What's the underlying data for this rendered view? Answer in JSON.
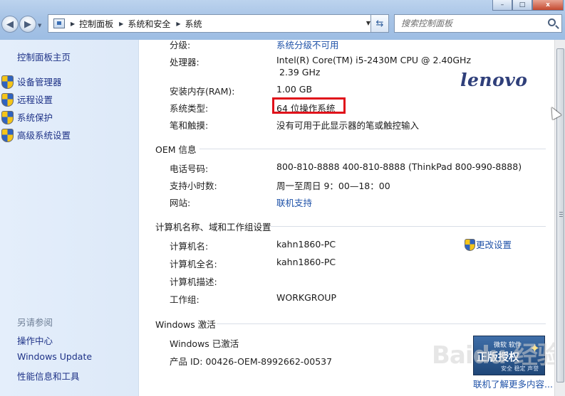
{
  "titlebar": {
    "back_icon": "back-arrow-icon",
    "forward_icon": "forward-arrow-icon",
    "breadcrumbs": [
      "控制面板",
      "系统和安全",
      "系统"
    ],
    "search_placeholder": "搜索控制面板",
    "window_buttons": {
      "minimize": "–",
      "maximize": "□",
      "close": "x"
    }
  },
  "sidebar": {
    "home_link": "控制面板主页",
    "items": [
      {
        "label": "设备管理器",
        "icon": "shield-icon"
      },
      {
        "label": "远程设置",
        "icon": "shield-icon"
      },
      {
        "label": "系统保护",
        "icon": "shield-icon"
      },
      {
        "label": "高级系统设置",
        "icon": "shield-icon"
      }
    ],
    "see_also_title": "另请参阅",
    "see_also_links": [
      "操作中心",
      "Windows Update",
      "性能信息和工具"
    ]
  },
  "system": {
    "rating_label": "分级:",
    "rating_value": "系统分级不可用",
    "processor_label": "处理器:",
    "processor_value_line1": "Intel(R) Core(TM) i5-2430M CPU @ 2.40GHz",
    "processor_value_line2": "2.39 GHz",
    "ram_label": "安装内存(RAM):",
    "ram_value": "1.00 GB",
    "type_label": "系统类型:",
    "type_value": "64 位操作系统",
    "pen_label": "笔和触摸:",
    "pen_value": "没有可用于此显示器的笔或触控输入",
    "logo_text": "lenovo"
  },
  "oem": {
    "title": "OEM 信息",
    "phone_label": "电话号码:",
    "phone_value": "800-810-8888 400-810-8888 (ThinkPad 800-990-8888)",
    "hours_label": "支持小时数:",
    "hours_value": "周一至周日 9：00—18：00",
    "website_label": "网站:",
    "website_value": "联机支持"
  },
  "computer": {
    "title": "计算机名称、域和工作组设置",
    "name_label": "计算机名:",
    "name_value": "kahn1860-PC",
    "fullname_label": "计算机全名:",
    "fullname_value": "kahn1860-PC",
    "desc_label": "计算机描述:",
    "desc_value": "",
    "workgroup_label": "工作组:",
    "workgroup_value": "WORKGROUP",
    "change_settings": "更改设置"
  },
  "activation": {
    "title": "Windows 激活",
    "status": "Windows 已激活",
    "product_id": "产品 ID: 00426-OEM-8992662-00537",
    "genuine_top": "微软 软件",
    "genuine_main": "正版授权",
    "genuine_bottom": "安全 稳定 声誉",
    "more_link": "联机了解更多内容..."
  },
  "watermark": "Baidu 经验"
}
